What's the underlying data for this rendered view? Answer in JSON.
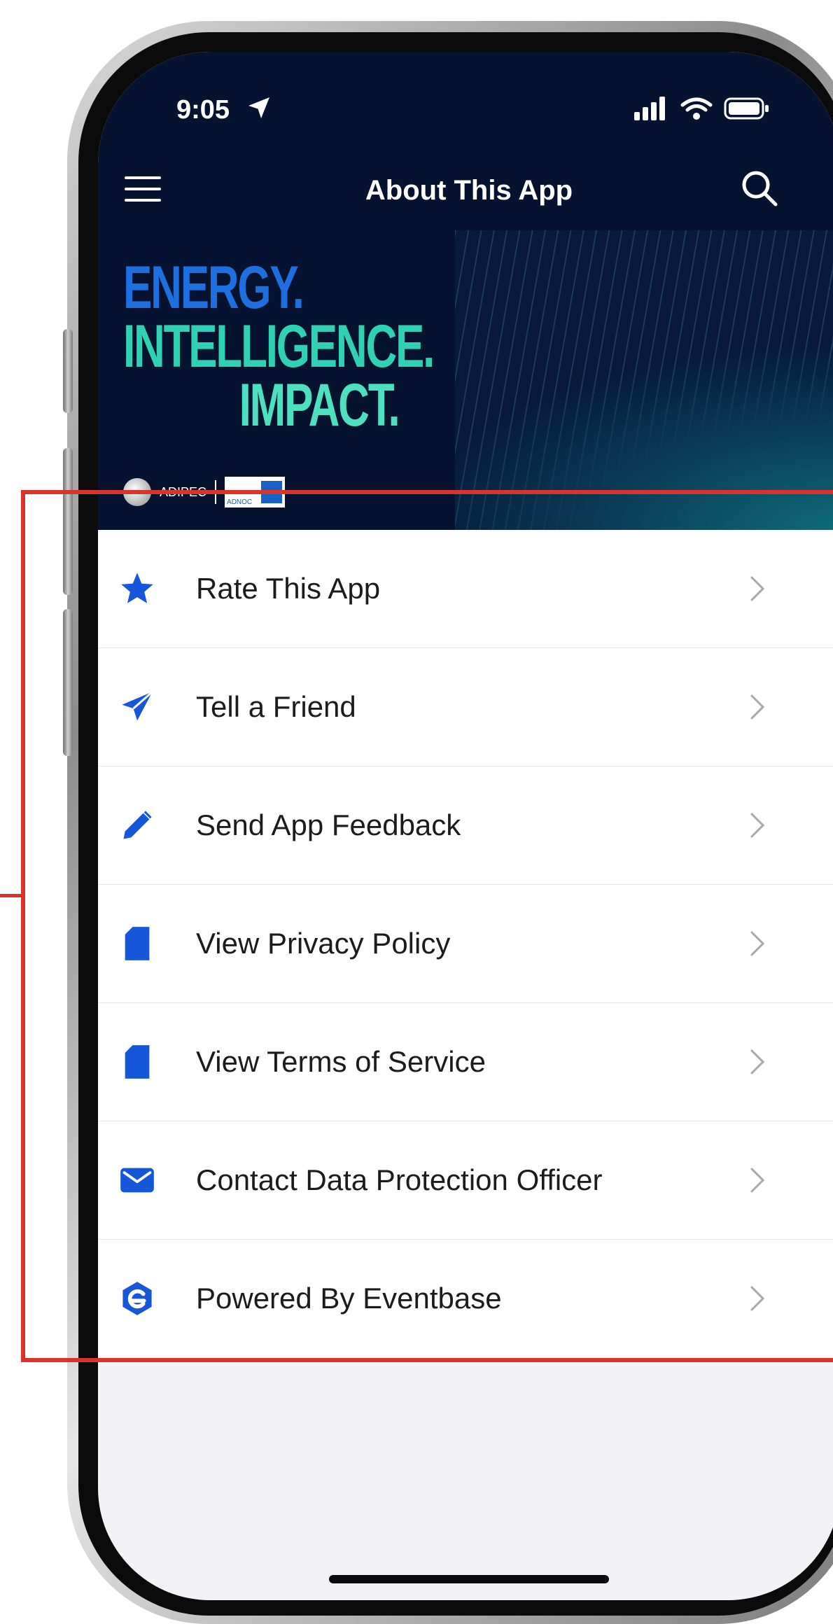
{
  "status_bar": {
    "time": "9:05"
  },
  "nav": {
    "title": "About This App"
  },
  "banner": {
    "line1": "ENERGY.",
    "line2": "INTELLIGENCE.",
    "line3": "IMPACT.",
    "logo_left": "ADIPEC",
    "logo_right": "ADNOC"
  },
  "menu": [
    {
      "label": "Rate This App",
      "icon": "star-icon"
    },
    {
      "label": "Tell a Friend",
      "icon": "paper-plane-icon"
    },
    {
      "label": "Send App Feedback",
      "icon": "pencil-icon"
    },
    {
      "label": "View Privacy Policy",
      "icon": "document-icon"
    },
    {
      "label": "View Terms of Service",
      "icon": "document-icon"
    },
    {
      "label": "Contact Data Protection Officer",
      "icon": "envelope-icon"
    },
    {
      "label": "Powered By Eventbase",
      "icon": "eventbase-logo-icon"
    }
  ],
  "colors": {
    "header_bg": "#061330",
    "icon_blue": "#1656d8",
    "annotation": "#d9342b"
  }
}
